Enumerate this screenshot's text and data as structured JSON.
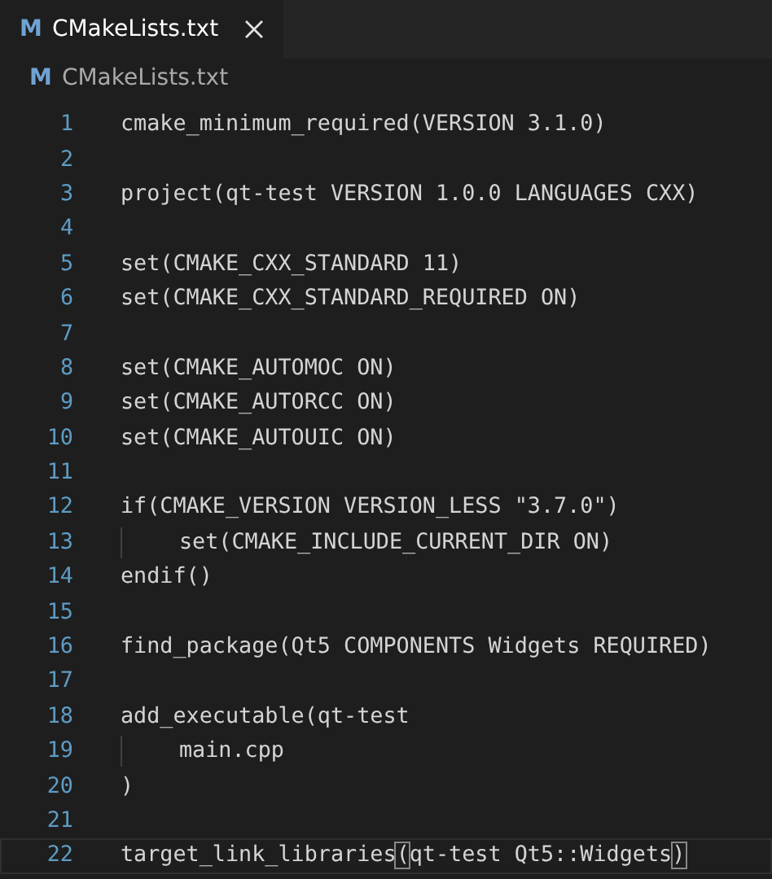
{
  "tab": {
    "icon_letter": "M",
    "label": "CMakeLists.txt",
    "selected": true
  },
  "breadcrumb": {
    "icon_letter": "M",
    "label": "CMakeLists.txt"
  },
  "lines": [
    {
      "number": "1",
      "text": "cmake_minimum_required(VERSION 3.1.0)",
      "selected": false
    },
    {
      "number": "2",
      "selected": false
    },
    {
      "number": "3",
      "text": "project(qt-test VERSION 1.0.0 LANGUAGES CXX)",
      "selected": false
    },
    {
      "number": "4",
      "selected": false
    },
    {
      "number": "5",
      "text": "set(CMAKE_CXX_STANDARD 11)",
      "selected": false
    },
    {
      "number": "6",
      "text": "set(CMAKE_CXX_STANDARD_REQUIRED ON)",
      "selected": false
    },
    {
      "number": "7",
      "selected": false
    },
    {
      "number": "8",
      "text": "set(CMAKE_AUTOMOC ON)",
      "selected": false
    },
    {
      "number": "9",
      "text": "set(CMAKE_AUTORCC ON)",
      "selected": false
    },
    {
      "number": "10",
      "text": "set(CMAKE_AUTOUIC ON)",
      "selected": false
    },
    {
      "number": "11",
      "selected": false
    },
    {
      "number": "12",
      "text": "if(CMAKE_VERSION VERSION_LESS \"3.7.0\")",
      "selected": false,
      "children": [
        {
          "number": "13",
          "text": "set(CMAKE_INCLUDE_CURRENT_DIR ON)",
          "selected": false
        }
      ]
    },
    {
      "number": "14",
      "text": "endif()",
      "selected": false
    },
    {
      "number": "15",
      "selected": false
    },
    {
      "number": "16",
      "text": "find_package(Qt5 COMPONENTS Widgets REQUIRED)",
      "selected": false
    },
    {
      "number": "17",
      "selected": false
    },
    {
      "number": "18",
      "text": "add_executable(qt-test",
      "selected": false,
      "children": [
        {
          "number": "19",
          "text": "main.cpp",
          "selected": false
        }
      ]
    },
    {
      "number": "20",
      "text": ")",
      "selected": false
    },
    {
      "number": "21",
      "selected": false
    },
    {
      "number": "22",
      "selected": true,
      "segments": [
        {
          "text": "target_link_libraries",
          "bracket_match": false
        },
        {
          "text": "(",
          "bracket_match": true
        },
        {
          "text": "qt-test Qt5::Widgets",
          "bracket_match": false
        },
        {
          "text": ")",
          "bracket_match": true
        }
      ]
    }
  ]
}
